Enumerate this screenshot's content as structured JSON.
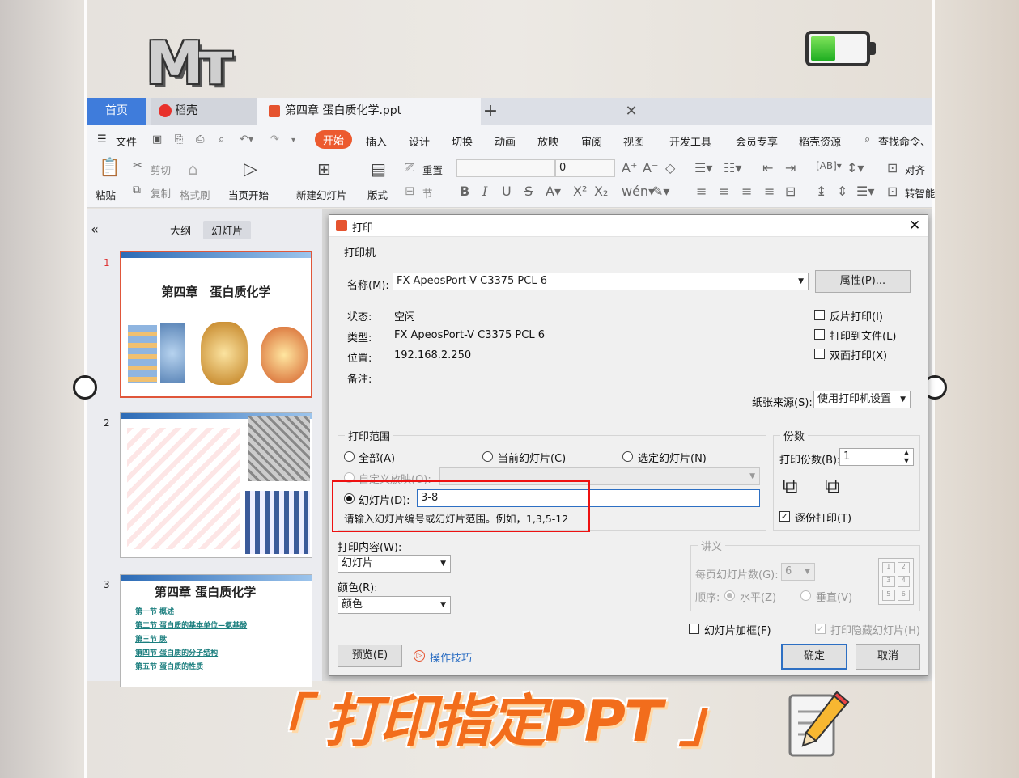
{
  "tabs": {
    "home": "首页",
    "docer": "稻壳",
    "doc": "第四章  蛋白质化学.ppt"
  },
  "menu": [
    "文件",
    "开始",
    "插入",
    "设计",
    "切换",
    "动画",
    "放映",
    "审阅",
    "视图",
    "开发工具",
    "会员专享",
    "稻壳资源",
    "查找命令、"
  ],
  "ribbon": {
    "paste": "粘贴",
    "cut": "剪切",
    "copy": "复制",
    "format_painter": "格式刷",
    "from_current": "当页开始",
    "new_slide": "新建幻灯片",
    "layout": "版式",
    "reset": "重置",
    "section": "节",
    "font_size": "0",
    "align": "对齐",
    "smart": "转智能"
  },
  "panel": {
    "outline_tab": "大纲",
    "slides_tab": "幻灯片",
    "slide_numbers": [
      "1",
      "2",
      "3"
    ],
    "slide1_title": "第四章　蛋白质化学",
    "slide3_title": "第四章  蛋白质化学",
    "slide3_items": [
      "第一节  概述",
      "第二节  蛋白质的基本单位—氨基酸",
      "第三节  肽",
      "第四节  蛋白质的分子结构",
      "第五节  蛋白质的性质"
    ]
  },
  "dialog": {
    "title": "打印",
    "printer_group": "打印机",
    "name_label": "名称(M):",
    "printer_name": "FX ApeosPort-V C3375 PCL 6",
    "properties_button": "属性(P)...",
    "status_label": "状态:",
    "status_value": "空闲",
    "type_label": "类型:",
    "type_value": "FX ApeosPort-V C3375 PCL 6",
    "location_label": "位置:",
    "location_value": "192.168.2.250",
    "comment_label": "备注:",
    "reverse_print": "反片打印(I)",
    "print_to_file": "打印到文件(L)",
    "duplex": "双面打印(X)",
    "paper_source_label": "纸张来源(S):",
    "paper_source_value": "使用打印机设置",
    "range_group": "打印范围",
    "range_all": "全部(A)",
    "range_current": "当前幻灯片(C)",
    "range_selected": "选定幻灯片(N)",
    "range_custom": "自定义放映(O):",
    "range_slides": "幻灯片(D):",
    "range_slides_value": "3-8",
    "range_hint": "请输入幻灯片编号或幻灯片范围。例如，1,3,5-12",
    "copies_group": "份数",
    "copies_label": "打印份数(B):",
    "copies_value": "1",
    "collate": "逐份打印(T)",
    "content_label": "打印内容(W):",
    "content_value": "幻灯片",
    "color_label": "颜色(R):",
    "color_value": "颜色",
    "handout_group": "讲义",
    "per_page_label": "每页幻灯片数(G):",
    "per_page_value": "6",
    "order_label": "顺序:",
    "order_horizontal": "水平(Z)",
    "order_vertical": "垂直(V)",
    "frame_slides": "幻灯片加框(F)",
    "print_hidden": "打印隐藏幻灯片(H)",
    "preview_button": "预览(E)",
    "tips_link": "操作技巧",
    "ok_button": "确定",
    "cancel_button": "取消"
  },
  "overlay": {
    "logo_text": "Mт",
    "caption": "「 打印指定PPT 」"
  },
  "colors": {
    "accent": "#3f7cdb",
    "start_tab": "#ec5a2f",
    "highlight": "#ee1111",
    "caption": "#f26d1c"
  }
}
